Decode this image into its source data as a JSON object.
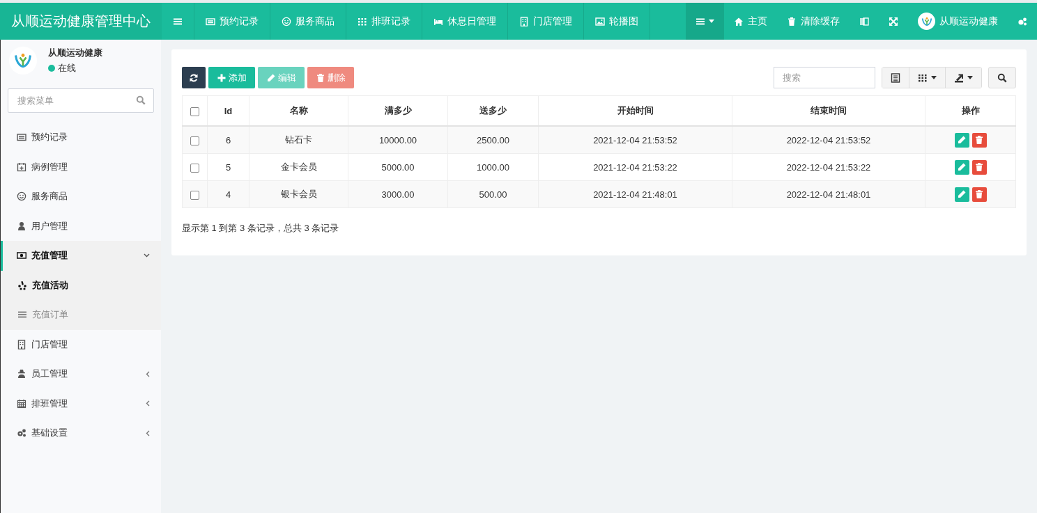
{
  "header": {
    "brand": "从顺运动健康管理中心",
    "nav": [
      {
        "label": "预约记录"
      },
      {
        "label": "服务商品"
      },
      {
        "label": "排班记录"
      },
      {
        "label": "休息日管理"
      },
      {
        "label": "门店管理"
      },
      {
        "label": "轮播图"
      }
    ],
    "links": [
      "主页",
      "清除缓存"
    ],
    "user_name": "从顺运动健康"
  },
  "sidebar": {
    "user": {
      "name": "从顺运动健康",
      "status": "在线",
      "online": true
    },
    "search": {
      "placeholder": "搜索菜单"
    },
    "items": [
      {
        "label": "预约记录",
        "selected": false
      },
      {
        "label": "病例管理",
        "selected": false
      },
      {
        "label": "服务商品",
        "selected": false
      },
      {
        "label": "用户管理",
        "selected": false
      },
      {
        "label": "充值管理",
        "selected": false,
        "expanded": true,
        "children": [
          {
            "label": "充值活动",
            "selected": true
          },
          {
            "label": "充值订单",
            "selected": false
          }
        ]
      },
      {
        "label": "门店管理",
        "selected": false
      },
      {
        "label": "员工管理",
        "selected": false,
        "expanded": false
      },
      {
        "label": "排班管理",
        "selected": false,
        "expanded": false
      },
      {
        "label": "基础设置",
        "selected": false,
        "expanded": false
      }
    ]
  },
  "toolbar": {
    "buttons": [
      {
        "label": "添加",
        "kind": "add",
        "disabled": false
      },
      {
        "label": "编辑",
        "kind": "edit",
        "disabled": true
      },
      {
        "label": "删除",
        "kind": "delete",
        "disabled": true
      }
    ],
    "search": {
      "placeholder": "搜索"
    }
  },
  "table": {
    "columns": [
      "Id",
      "名称",
      "满多少",
      "送多少",
      "开始时间",
      "结束时间",
      "操作"
    ],
    "all_checked": false,
    "rows": [
      {
        "checked": false,
        "cells": [
          "6",
          "钻石卡",
          "10000.00",
          "2500.00",
          "2021-12-04 21:53:52",
          "2022-12-04 21:53:52"
        ]
      },
      {
        "checked": false,
        "cells": [
          "5",
          "金卡会员",
          "5000.00",
          "1000.00",
          "2021-12-04 21:53:22",
          "2022-12-04 21:53:22"
        ]
      },
      {
        "checked": false,
        "cells": [
          "4",
          "银卡会员",
          "3000.00",
          "500.00",
          "2021-12-04 21:48:01",
          "2022-12-04 21:48:01"
        ]
      }
    ]
  },
  "pagination_text": "显示第 1 到第 3 条记录，总共 3 条记录"
}
